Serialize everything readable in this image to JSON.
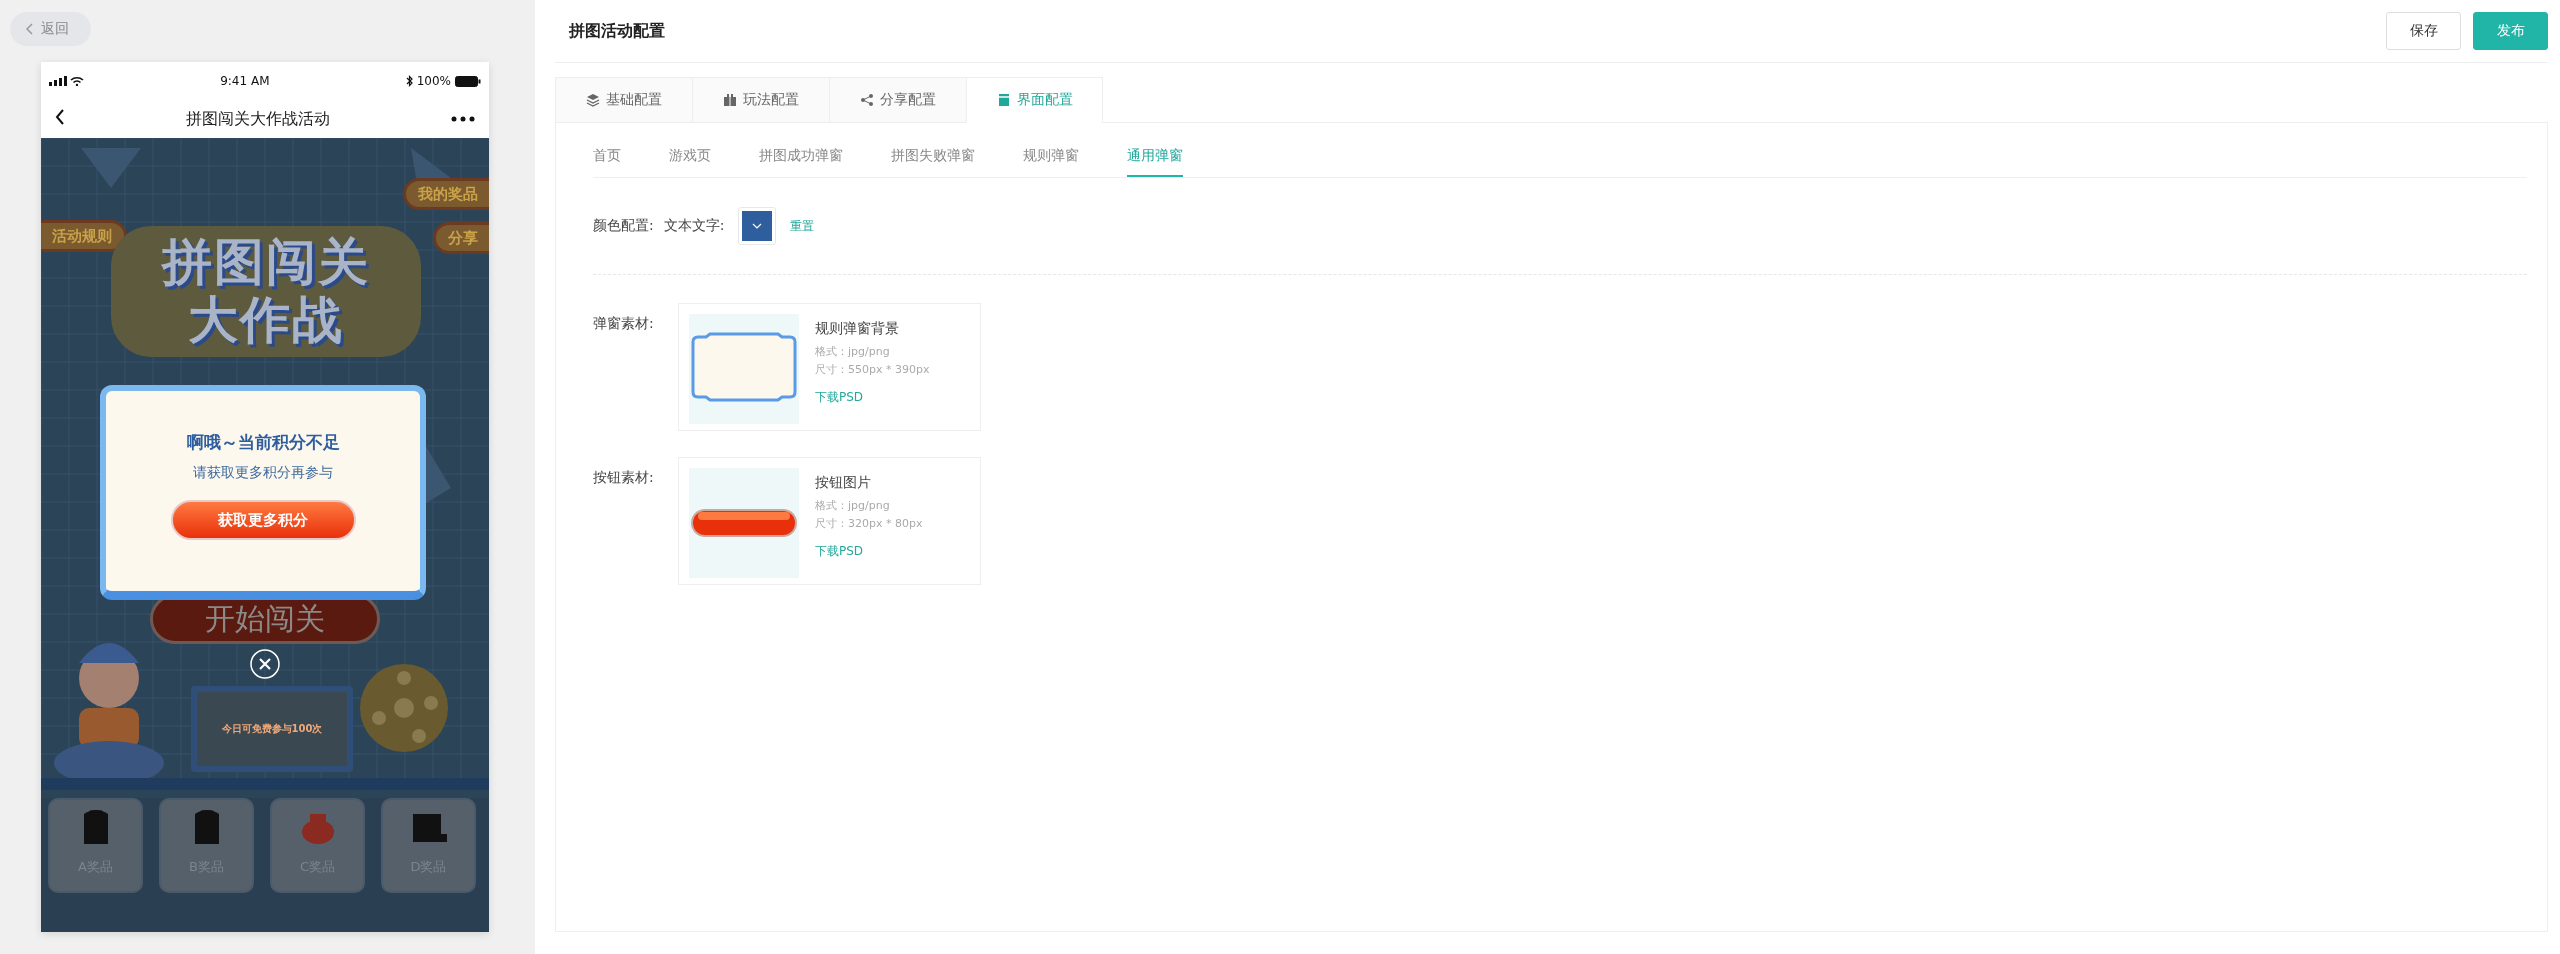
{
  "back_button": {
    "label": "返回"
  },
  "phone": {
    "status_bar": {
      "time": "9:41 AM",
      "battery": "100%"
    },
    "nav_bar": {
      "title": "拼图闯关大作战活动"
    },
    "game_page": {
      "left_buttons": [
        "活动规则"
      ],
      "right_buttons": [
        "我的奖品",
        "分享"
      ],
      "title_art": [
        "拼图闯关",
        "大作战"
      ],
      "start_button": "开始闯关",
      "free_plays": "今日可免费参与100次",
      "prizes": [
        {
          "label": "A奖品",
          "kind": "backpack"
        },
        {
          "label": "B奖品",
          "kind": "backpack"
        },
        {
          "label": "C奖品",
          "kind": "bag"
        },
        {
          "label": "D奖品",
          "kind": "console"
        }
      ]
    },
    "dialog": {
      "title": "啊哦～当前积分不足",
      "message": "请获取更多积分再参与",
      "button": "获取更多积分"
    }
  },
  "page_title": "拼图活动配置",
  "header_buttons": [
    {
      "label": "保存",
      "kind": "default"
    },
    {
      "label": "发布",
      "kind": "primary"
    }
  ],
  "tabs": [
    {
      "label": "基础配置",
      "selected": false
    },
    {
      "label": "玩法配置",
      "selected": false
    },
    {
      "label": "分享配置",
      "selected": false
    },
    {
      "label": "界面配置",
      "selected": true
    }
  ],
  "sub_tabs": [
    {
      "label": "首页",
      "selected": false
    },
    {
      "label": "游戏页",
      "selected": false
    },
    {
      "label": "拼图成功弹窗",
      "selected": false
    },
    {
      "label": "拼图失败弹窗",
      "selected": false
    },
    {
      "label": "规则弹窗",
      "selected": false
    },
    {
      "label": "通用弹窗",
      "selected": true
    }
  ],
  "color_config": {
    "label": "颜色配置:",
    "field_label": "文本文字:",
    "color": "#2e5e9e",
    "reset": "重置"
  },
  "materials": [
    {
      "label": "弹窗素材:",
      "kind": "dialog",
      "name": "规则弹窗背景",
      "format": "格式：jpg/png",
      "size": "尺寸：550px * 390px",
      "link": "下载PSD"
    },
    {
      "label": "按钮素材:",
      "kind": "button",
      "name": "按钮图片",
      "format": "格式：jpg/png",
      "size": "尺寸：320px * 80px",
      "link": "下载PSD"
    }
  ]
}
